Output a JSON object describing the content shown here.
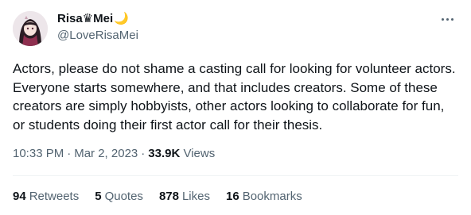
{
  "author": {
    "display_name": "Risa♛Mei",
    "display_emoji": "🌙",
    "handle": "@LoveRisaMei"
  },
  "tweet": {
    "text": "Actors, please do not shame a casting call for looking for volunteer actors. Everyone starts somewhere, and that includes creators. Some of these creators are simply hobbyists, other actors looking to collaborate for fun, or students doing their first actor call for their thesis.",
    "time": "10:33 PM",
    "date": "Mar 2, 2023",
    "views_count": "33.9K",
    "views_label": "Views"
  },
  "stats": {
    "retweets": {
      "count": "94",
      "label": "Retweets"
    },
    "quotes": {
      "count": "5",
      "label": "Quotes"
    },
    "likes": {
      "count": "878",
      "label": "Likes"
    },
    "bookmarks": {
      "count": "16",
      "label": "Bookmarks"
    }
  },
  "icons": {
    "more": "more-horizontal-icon"
  }
}
